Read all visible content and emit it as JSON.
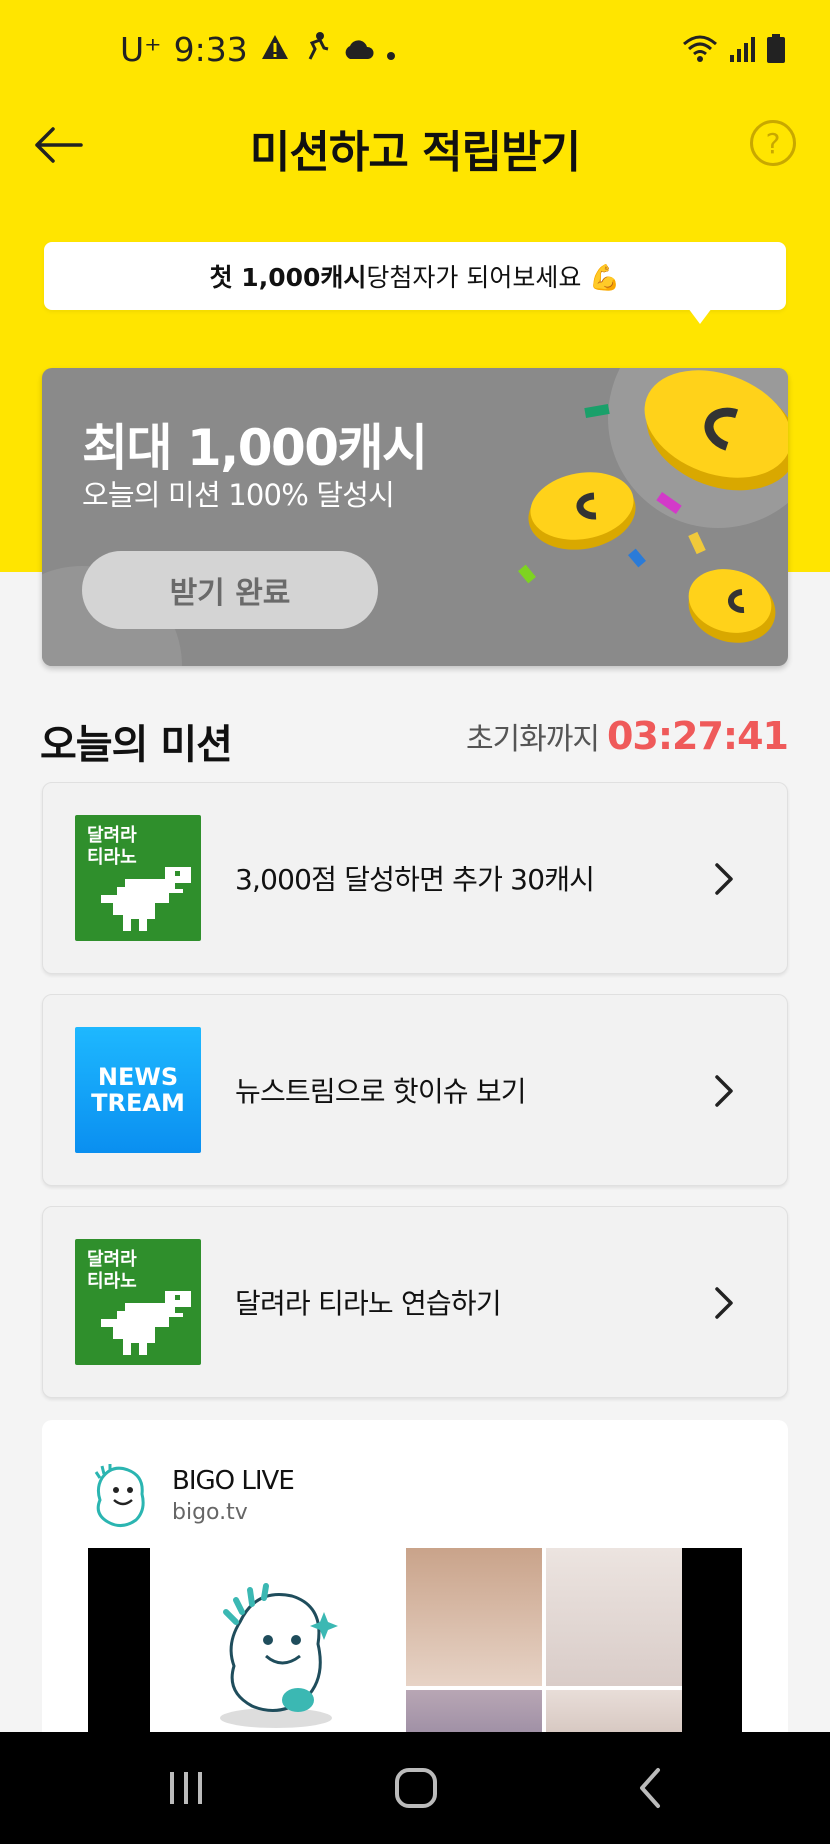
{
  "status_bar": {
    "carrier": "U⁺",
    "time": "9:33"
  },
  "header": {
    "title": "미션하고 적립받기",
    "help": "?"
  },
  "tooltip": {
    "bold_text": "첫 1,000캐시",
    "text": " 당첨자가 되어보세요 💪"
  },
  "promo": {
    "title": "최대 1,000캐시",
    "subtitle": "오늘의 미션 100% 달성시",
    "button_label": "받기 완료"
  },
  "missions_section": {
    "title": "오늘의 미션",
    "reset_label": "초기화까지",
    "reset_time": "03:27:41"
  },
  "missions": [
    {
      "thumb": "달려라\n티라노",
      "label": "3,000점 달성하면 추가 30캐시"
    },
    {
      "thumb": "NEWS\nTREAM",
      "label": "뉴스트림으로 핫이슈 보기"
    },
    {
      "thumb": "달려라\n티라노",
      "label": "달려라 티라노 연습하기"
    }
  ],
  "ad": {
    "name": "BIGO LIVE",
    "domain": "bigo.tv"
  },
  "colors": {
    "brand_yellow": "#ffe500",
    "promo_gray": "#8a8a8a",
    "timer_red": "#ef5a5a"
  }
}
